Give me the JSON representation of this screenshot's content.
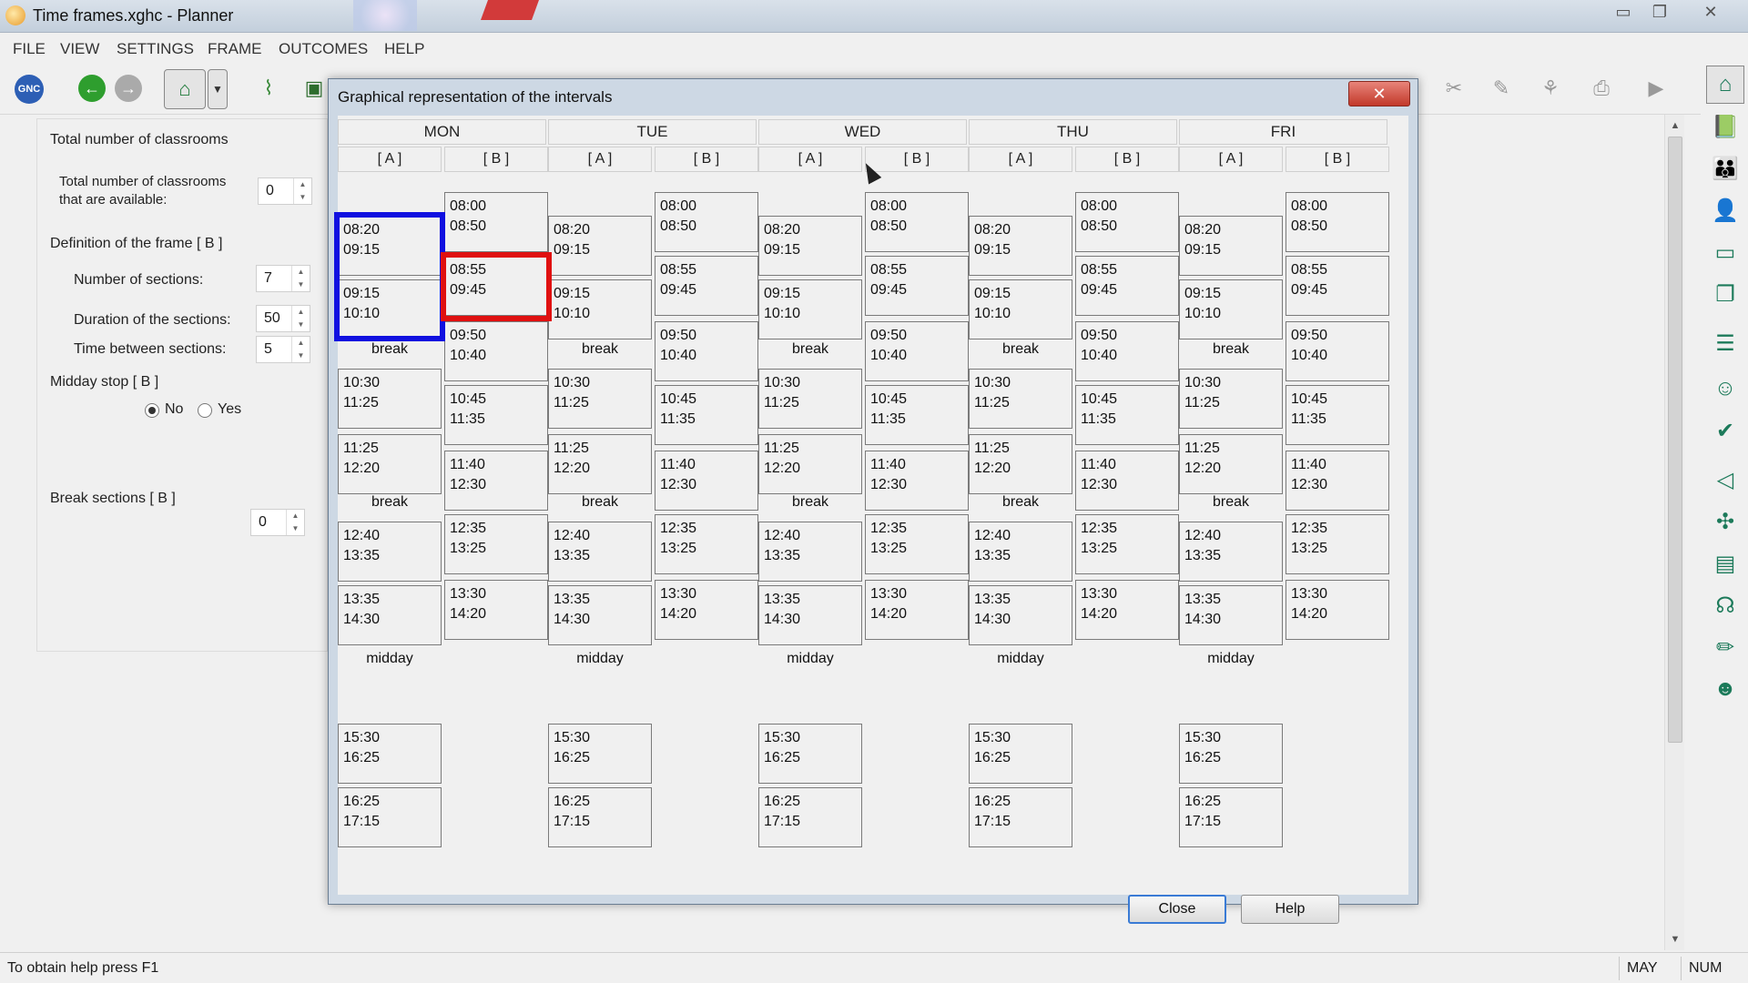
{
  "window": {
    "title": "Time frames.xghc - Planner",
    "minimize": "▭",
    "maximize": "❐",
    "close": "✕"
  },
  "menu": [
    "FILE",
    "VIEW",
    "SETTINGS",
    "FRAME",
    "OUTCOMES",
    "HELP"
  ],
  "toolbar": {
    "gnc_label": "GNC"
  },
  "left_panel": {
    "classrooms_section": "Total number of classrooms",
    "classrooms_label_line1": "Total number of classrooms",
    "classrooms_label_line2": "that are available:",
    "classrooms_value": "0",
    "frame_section": "Definition of the frame [ B ]",
    "sections_label": "Number of sections:",
    "sections_value": "7",
    "duration_label": "Duration of the sections:",
    "duration_value": "50",
    "between_label": "Time between sections:",
    "between_value": "5",
    "midday_section": "Midday stop [ B ]",
    "radio_no": "No",
    "radio_yes": "Yes",
    "midday_selected": "No",
    "break_sections_label": "Break sections [ B ]",
    "break_sections_value": "0"
  },
  "dialog": {
    "title": "Graphical representation of the intervals",
    "close_x": "✕",
    "close_button": "Close",
    "help_button": "Help",
    "days": [
      "MON",
      "TUE",
      "WED",
      "THU",
      "FRI"
    ],
    "frame_a_label": "[ A ]",
    "frame_b_label": "[ B ]",
    "frame_a": {
      "slots": [
        {
          "start": "08:20",
          "end": "09:15"
        },
        {
          "start": "09:15",
          "end": "10:10"
        },
        {
          "label": "break"
        },
        {
          "start": "10:30",
          "end": "11:25"
        },
        {
          "start": "11:25",
          "end": "12:20"
        },
        {
          "label": "break"
        },
        {
          "start": "12:40",
          "end": "13:35"
        },
        {
          "start": "13:35",
          "end": "14:30"
        },
        {
          "label": "midday"
        },
        {
          "start": "15:30",
          "end": "16:25"
        },
        {
          "start": "16:25",
          "end": "17:15"
        }
      ]
    },
    "frame_b": {
      "slots": [
        {
          "start": "08:00",
          "end": "08:50"
        },
        {
          "start": "08:55",
          "end": "09:45"
        },
        {
          "start": "09:50",
          "end": "10:40"
        },
        {
          "start": "10:45",
          "end": "11:35"
        },
        {
          "start": "11:40",
          "end": "12:30"
        },
        {
          "start": "12:35",
          "end": "13:25"
        },
        {
          "start": "13:30",
          "end": "14:20"
        }
      ]
    }
  },
  "statusbar": {
    "message": "To obtain help press F1",
    "ind1": "MAY",
    "ind2": "NUM"
  },
  "colors": {
    "highlight_blue": "#1010e0",
    "highlight_red": "#e01010"
  }
}
